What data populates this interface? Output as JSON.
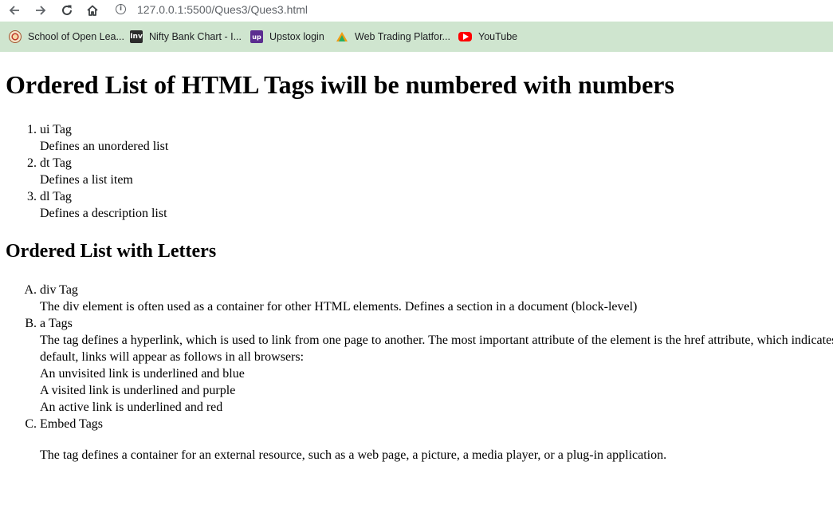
{
  "browser": {
    "url": "127.0.0.1:5500/Ques3/Ques3.html",
    "bookmarks": [
      {
        "label": "School of Open Lea...",
        "icon": "school-logo-icon"
      },
      {
        "label": "Nifty Bank Chart - I...",
        "icon": "inv-logo-icon"
      },
      {
        "label": "Upstox login",
        "icon": "upstox-logo-icon"
      },
      {
        "label": "Web Trading Platfor...",
        "icon": "trading-logo-icon"
      },
      {
        "label": "YouTube",
        "icon": "youtube-logo-icon"
      }
    ]
  },
  "page": {
    "heading1": "Ordered List of HTML Tags iwill be numbered with numbers",
    "numbered_list": [
      {
        "marker": "1.",
        "term": "ui Tag",
        "desc": "Defines an unordered list"
      },
      {
        "marker": "2.",
        "term": "dt Tag",
        "desc": "Defines a list item"
      },
      {
        "marker": "3.",
        "term": "dl Tag",
        "desc": "Defines a description list"
      }
    ],
    "heading2": "Ordered List with Letters",
    "lettered_list": [
      {
        "marker": "A.",
        "term": "div Tag",
        "lines": [
          "The div element is often used as a container for other HTML elements. Defines a section in a document (block-level)"
        ]
      },
      {
        "marker": "B.",
        "term": "a Tags",
        "lines": [
          "The tag defines a hyperlink, which is used to link from one page to another. The most important attribute of the element is the href attribute, which indicates the link's destination. By",
          "default, links will appear as follows in all browsers:",
          "An unvisited link is underlined and blue",
          "A visited link is underlined and purple",
          "An active link is underlined and red"
        ]
      },
      {
        "marker": "C.",
        "term": "Embed Tags",
        "lines": [
          "The tag defines a container for an external resource, such as a web page, a picture, a media player, or a plug-in application."
        ]
      }
    ]
  },
  "colors": {
    "bookmark_bar": "#cfe5cf",
    "toolbar": "#ffffff",
    "nav_icon": "#5f6368"
  }
}
